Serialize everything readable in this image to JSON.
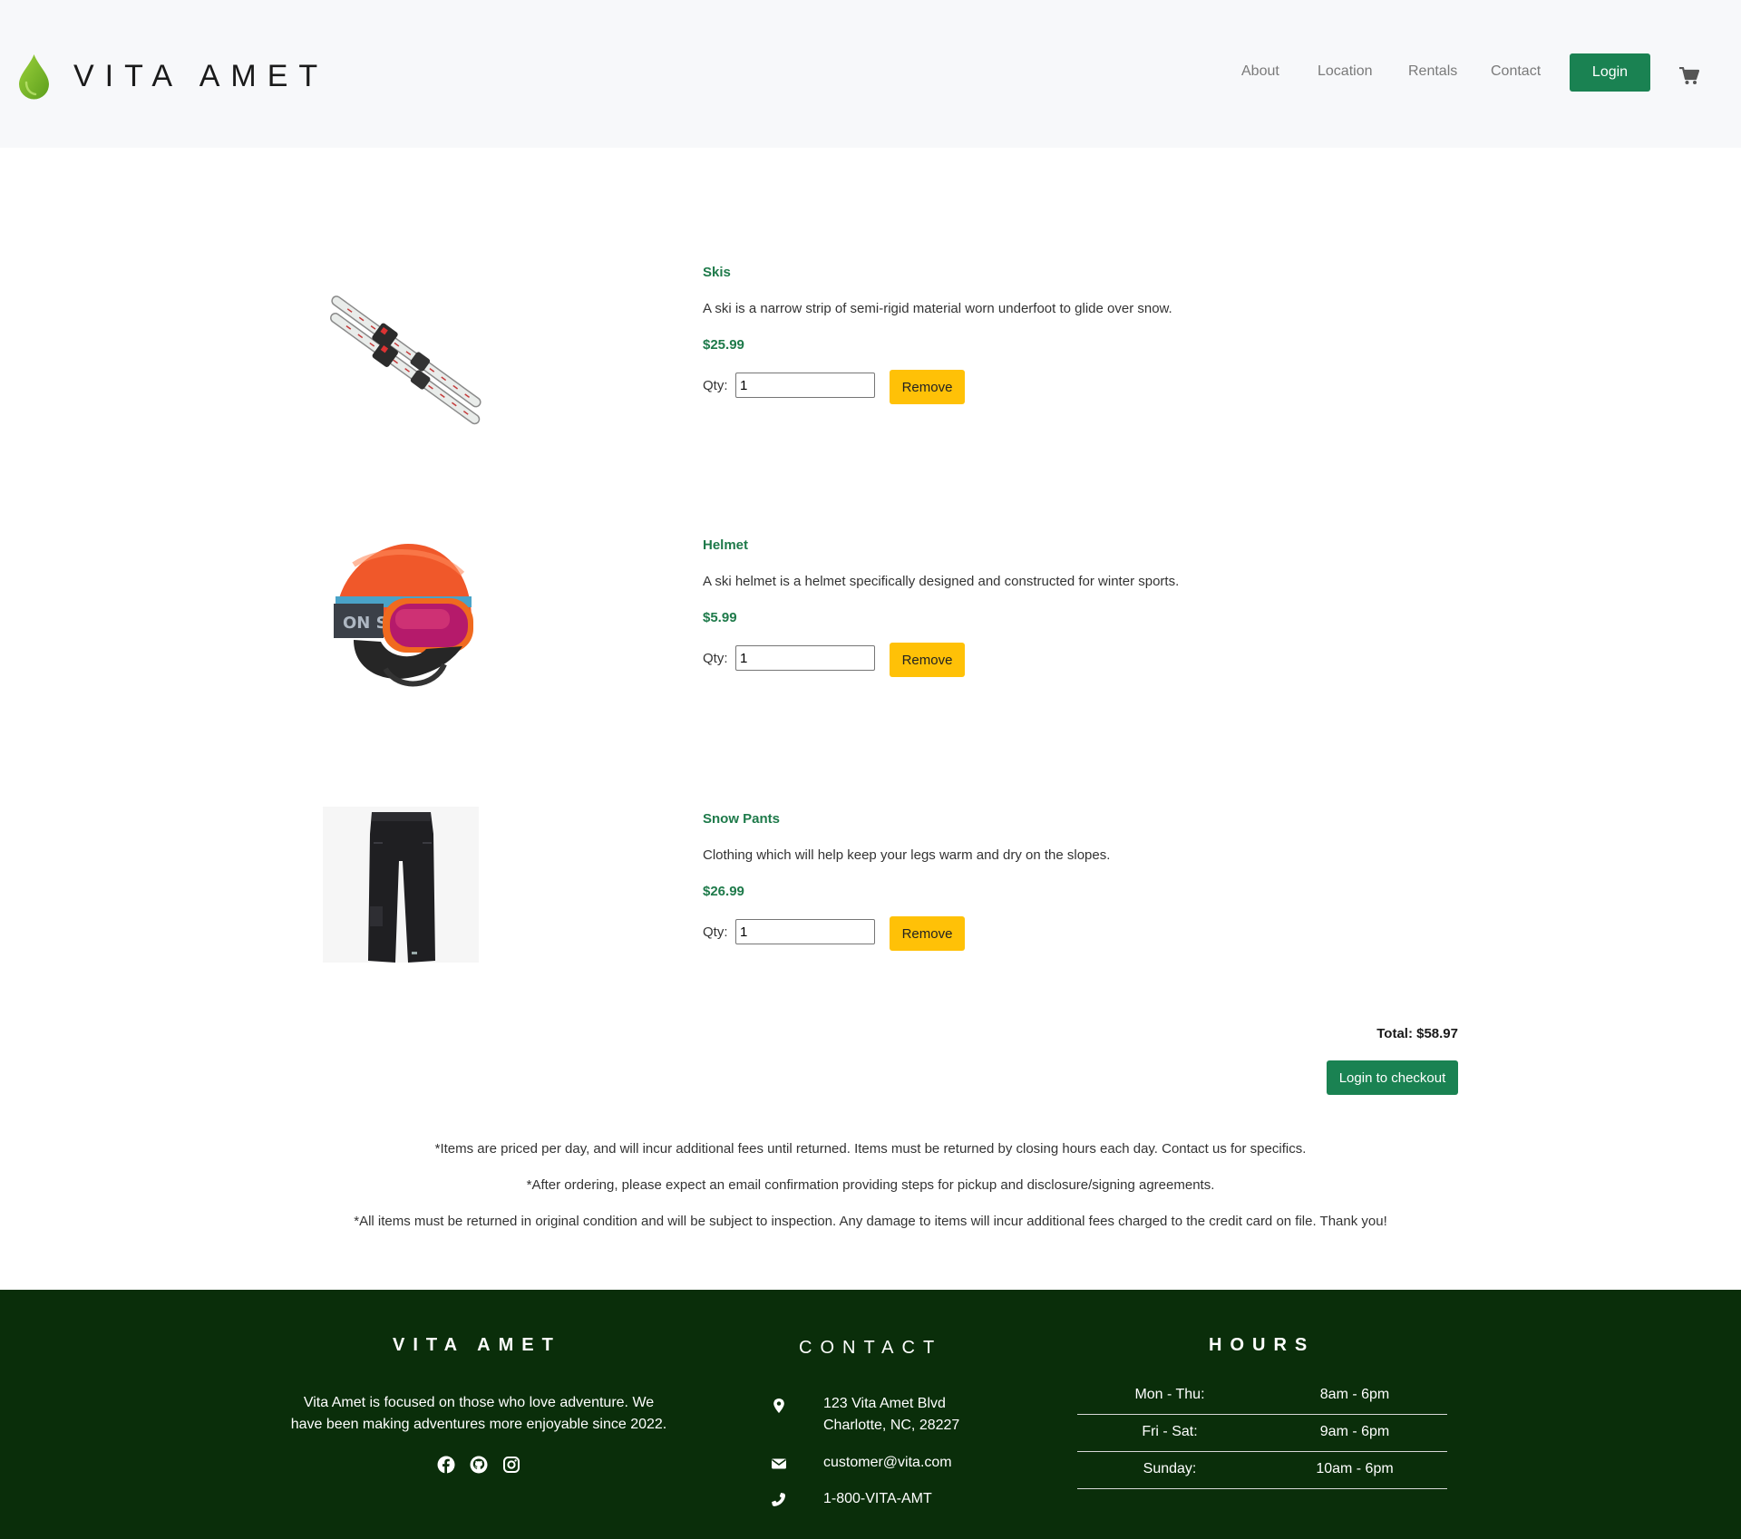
{
  "header": {
    "brand": "VITA AMET",
    "nav": [
      "About",
      "Location",
      "Rentals",
      "Contact"
    ],
    "login_label": "Login"
  },
  "items": [
    {
      "title": "Skis",
      "description": "A ski is a narrow strip of semi-rigid material worn underfoot to glide over snow.",
      "price": "$25.99",
      "qty_label": "Qty:",
      "qty": "1",
      "remove_label": "Remove"
    },
    {
      "title": "Helmet",
      "description": "A ski helmet is a helmet specifically designed and constructed for winter sports.",
      "price": "$5.99",
      "qty_label": "Qty:",
      "qty": "1",
      "remove_label": "Remove"
    },
    {
      "title": "Snow Pants",
      "description": "Clothing which will help keep your legs warm and dry on the slopes.",
      "price": "$26.99",
      "qty_label": "Qty:",
      "qty": "1",
      "remove_label": "Remove"
    }
  ],
  "summary": {
    "total": "Total: $58.97",
    "checkout_label": "Login to checkout"
  },
  "notes": [
    "*Items are priced per day, and will incur additional fees until returned. Items must be returned by closing hours each day. Contact us for specifics.",
    "*After ordering, please expect an email confirmation providing steps for pickup and disclosure/signing agreements.",
    "*All items must be returned in original condition and will be subject to inspection. Any damage to items will incur additional fees charged to the credit card on file. Thank you!"
  ],
  "footer": {
    "about_title": "VITA AMET",
    "about_text": "Vita Amet is focused on those who love adventure. We have been making adventures more enjoyable since 2022.",
    "contact_title": "CONTACT",
    "address_line1": "123 Vita Amet Blvd",
    "address_line2": "Charlotte, NC, 28227",
    "email": "customer@vita.com",
    "phone": "1-800-VITA-AMT",
    "hours_title": "HOURS",
    "hours": [
      {
        "day": "Mon - Thu:",
        "time": "8am - 6pm"
      },
      {
        "day": "Fri - Sat:",
        "time": "9am - 6pm"
      },
      {
        "day": "Sunday:",
        "time": "10am - 6pm"
      }
    ]
  },
  "colors": {
    "primary_green": "#1a8252",
    "title_green": "#1e7a4a",
    "remove_yellow": "#ffc107",
    "footer_bg": "#0a2e0a",
    "header_bg": "#f7f8fa"
  },
  "icons": [
    "leaf-drop-logo-icon",
    "cart-icon",
    "map-marker-icon",
    "envelope-icon",
    "phone-icon",
    "facebook-icon",
    "github-icon",
    "instagram-icon"
  ]
}
